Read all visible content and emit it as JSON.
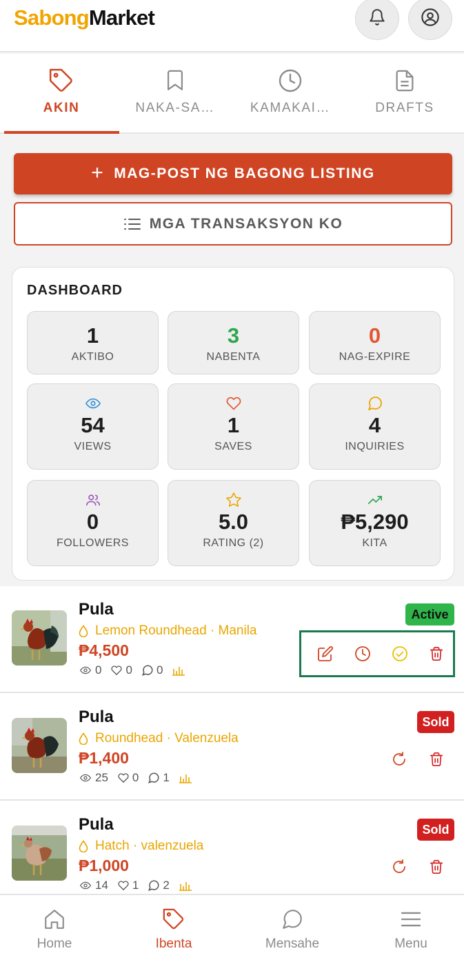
{
  "app": {
    "logo_part1": "Sabong",
    "logo_part2": "Market",
    "accent_color": "#cf4524",
    "brand_color": "#f2a400"
  },
  "header": {
    "notifications_icon": "bell-icon",
    "profile_icon": "user-circle-icon"
  },
  "tabs": [
    {
      "label": "AKIN",
      "icon": "tag-icon",
      "active": true
    },
    {
      "label": "NAKA-SA…",
      "icon": "bookmark-icon",
      "active": false
    },
    {
      "label": "KAMAKAI…",
      "icon": "clock-icon",
      "active": false
    },
    {
      "label": "DRAFTS",
      "icon": "document-icon",
      "active": false
    }
  ],
  "actions": {
    "post_plus": "+",
    "post_label": "MAG-POST NG BAGONG LISTING",
    "transactions_label": "MGA TRANSAKSYON KO"
  },
  "dashboard": {
    "title": "DASHBOARD",
    "stats": [
      {
        "value": "1",
        "label": "AKTIBO",
        "color": "#1d1d1d"
      },
      {
        "value": "3",
        "label": "NABENTA",
        "color": "#2fa54f"
      },
      {
        "value": "0",
        "label": "NAG-EXPIRE",
        "color": "#e25530"
      },
      {
        "value": "54",
        "label": "VIEWS",
        "icon": "eye-icon",
        "icon_color": "#2f8fd8"
      },
      {
        "value": "1",
        "label": "SAVES",
        "icon": "heart-icon",
        "icon_color": "#e25530"
      },
      {
        "value": "4",
        "label": "INQUIRIES",
        "icon": "chat-icon",
        "icon_color": "#e9a600"
      },
      {
        "value": "0",
        "label": "FOLLOWERS",
        "icon": "users-icon",
        "icon_color": "#9b59b6"
      },
      {
        "value": "5.0",
        "label": "RATING (2)",
        "icon": "star-icon",
        "icon_color": "#e9a600"
      },
      {
        "value": "₱5,290",
        "label": "KITA",
        "icon": "trending-up-icon",
        "icon_color": "#2fa54f"
      }
    ]
  },
  "listings": [
    {
      "title": "Pula",
      "subtitle": "Lemon Roundhead · Manila",
      "price": "₱4,500",
      "views": "0",
      "saves": "0",
      "inquiries": "0",
      "status": "Active"
    },
    {
      "title": "Pula",
      "subtitle": "Roundhead · Valenzuela",
      "price": "₱1,400",
      "views": "25",
      "saves": "0",
      "inquiries": "1",
      "status": "Sold"
    },
    {
      "title": "Pula",
      "subtitle": "Hatch · valenzuela",
      "price": "₱1,000",
      "views": "14",
      "saves": "1",
      "inquiries": "2",
      "status": "Sold"
    }
  ],
  "bottom_nav": [
    {
      "label": "Home",
      "icon": "home-icon",
      "active": false
    },
    {
      "label": "Ibenta",
      "icon": "tag-icon",
      "active": true
    },
    {
      "label": "Mensahe",
      "icon": "chat-icon",
      "active": false
    },
    {
      "label": "Menu",
      "icon": "menu-icon",
      "active": false
    }
  ]
}
